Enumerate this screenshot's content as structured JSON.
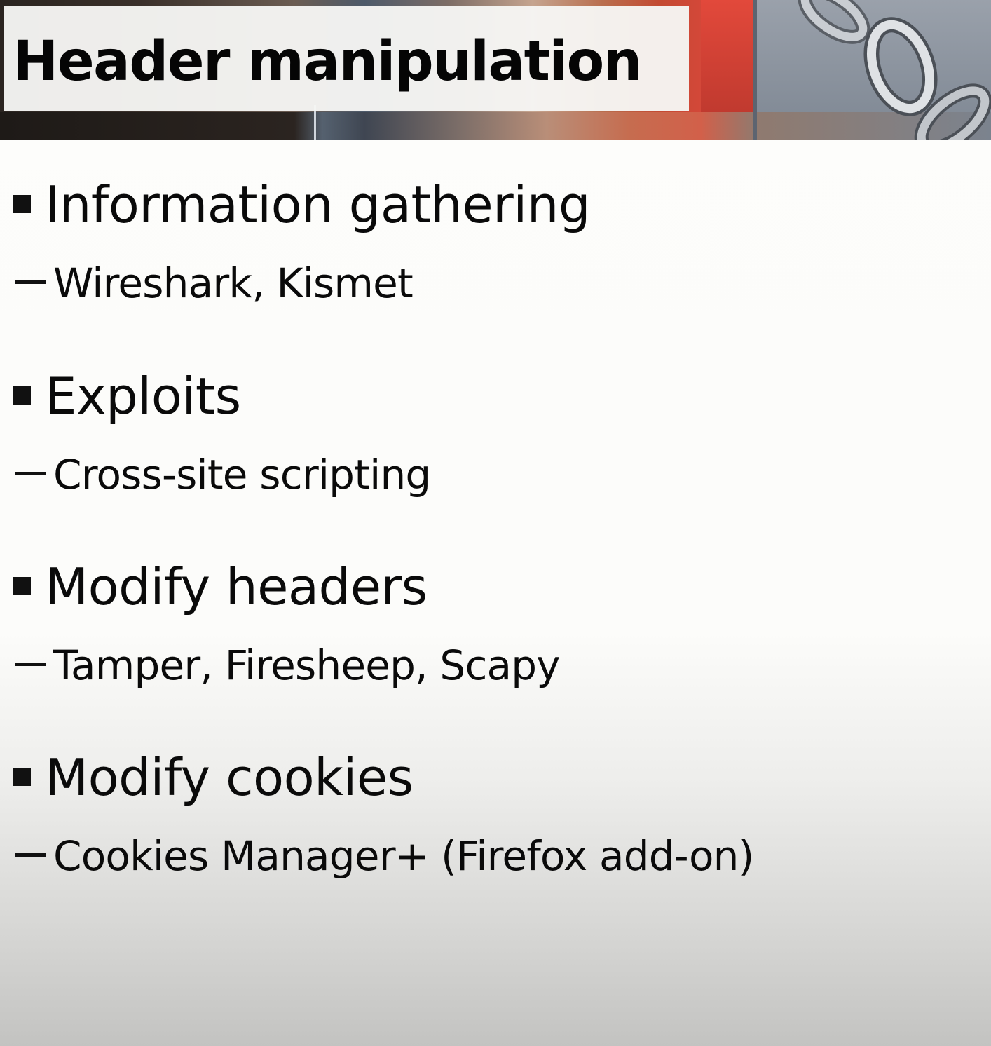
{
  "slide": {
    "title": "Header manipulation",
    "bullets": [
      {
        "label": "Information gathering",
        "sub": "Wireshark, Kismet"
      },
      {
        "label": "Exploits",
        "sub": "Cross-site scripting"
      },
      {
        "label": "Modify headers",
        "sub": "Tamper, Firesheep, Scapy"
      },
      {
        "label": "Modify cookies",
        "sub": "Cookies Manager+ (Firefox add-on)"
      }
    ],
    "banner_image": "chain-and-padlock-photo",
    "colors": {
      "title_box": "#f6f6f4",
      "text": "#0a0a0a",
      "banner_accent": "#d6473a"
    }
  }
}
